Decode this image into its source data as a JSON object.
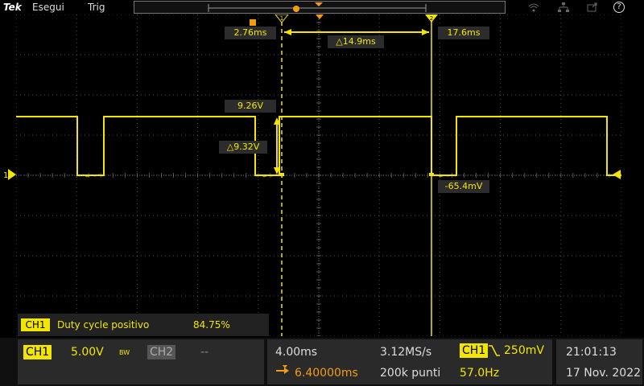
{
  "topbar": {
    "logo": "Tek",
    "menu": [
      "Esegui",
      "Trig"
    ],
    "icons": [
      "wifi-icon",
      "network-icon",
      "export-icon",
      "help-icon"
    ],
    "help_glyph": "?"
  },
  "channel_marker": {
    "label": "1"
  },
  "cursor_markers": {
    "a": "1",
    "b": "2"
  },
  "cursors": {
    "a_time": "2.76ms",
    "b_time": "17.6ms",
    "delta_time": "△14.9ms",
    "a_voltage": "9.26V",
    "b_voltage": "-65.4mV",
    "delta_voltage": "△9.32V"
  },
  "measurement": {
    "channel": "CH1",
    "name": "Duty cycle positivo",
    "value": "84.75%"
  },
  "vertical": {
    "ch1_label": "CH1",
    "ch1_scale": "5.00V",
    "bw_glyph": "BW",
    "ch2_label": "CH2",
    "ch2_scale": "--"
  },
  "horizontal": {
    "timebase": "4.00ms",
    "position": "6.40000ms",
    "sample_rate": "3.12MS/s",
    "record_length": "200k punti"
  },
  "trigger": {
    "source": "CH1",
    "level": "250mV",
    "frequency": "57.0Hz"
  },
  "clock": {
    "time": "21:01:13",
    "date": "17 Nov. 2022"
  },
  "colors": {
    "ch1": "#f2e600",
    "trigger_marker": "#f39c12",
    "background": "#000000"
  }
}
